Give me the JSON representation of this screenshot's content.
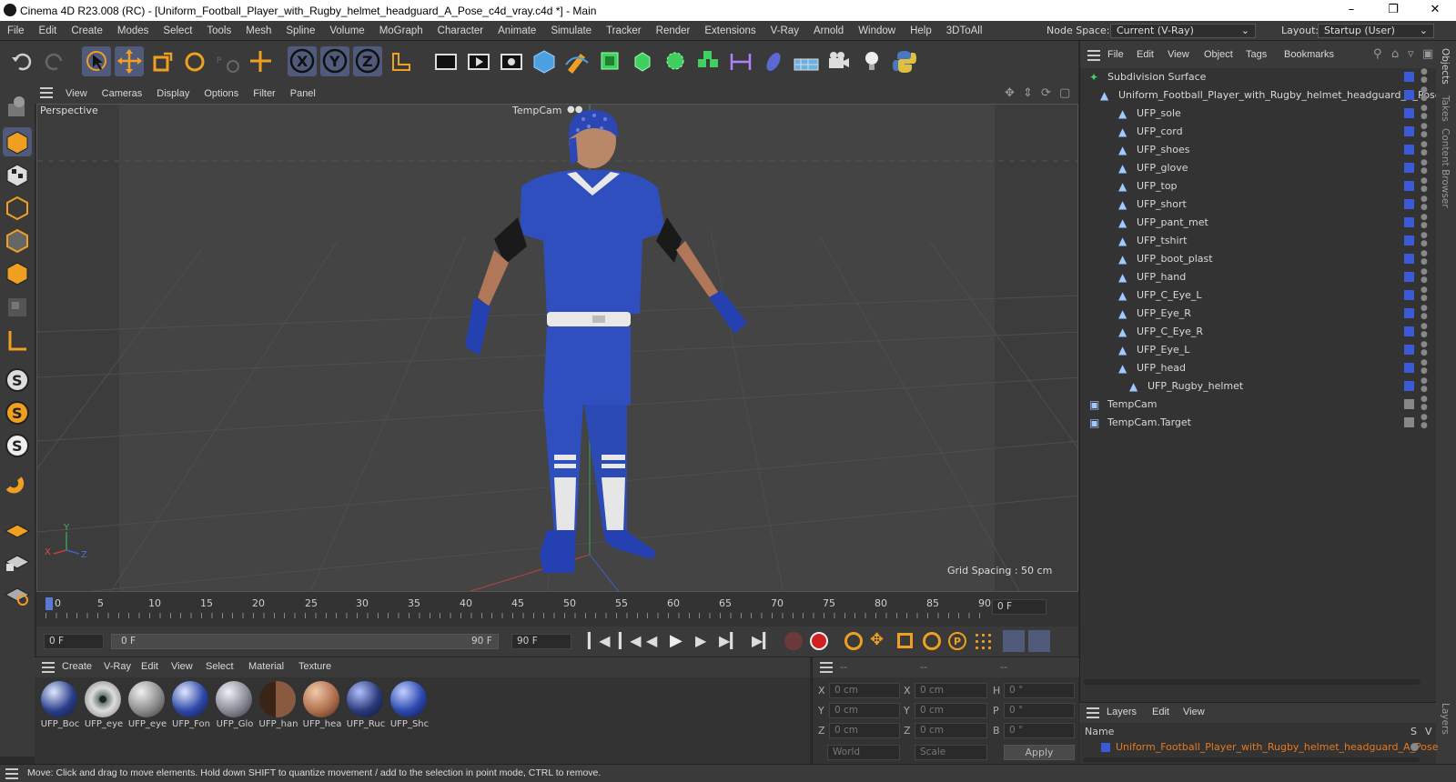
{
  "window": {
    "title": "Cinema 4D R23.008 (RC) - [Uniform_Football_Player_with_Rugby_helmet_headguard_A_Pose_c4d_vray.c4d *] - Main",
    "controls": [
      "–",
      "❐",
      "✕"
    ]
  },
  "menubar": {
    "items": [
      "File",
      "Edit",
      "Create",
      "Modes",
      "Select",
      "Tools",
      "Mesh",
      "Spline",
      "Volume",
      "MoGraph",
      "Character",
      "Animate",
      "Simulate",
      "Tracker",
      "Render",
      "Extensions",
      "V-Ray",
      "Arnold",
      "Window",
      "Help",
      "3DToAll"
    ],
    "node_space_label": "Node Space:",
    "node_space_value": "Current (V-Ray)",
    "layout_label": "Layout:",
    "layout_value": "Startup (User)"
  },
  "viewport": {
    "menu": [
      "View",
      "Cameras",
      "Display",
      "Options",
      "Filter",
      "Panel"
    ],
    "view_name": "Perspective",
    "camera_label": "TempCam",
    "grid_spacing": "Grid Spacing : 50 cm",
    "axis_labels": {
      "y": "Y",
      "x": "X",
      "z": "Z"
    }
  },
  "timeline": {
    "ticks": [
      "0",
      "5",
      "10",
      "15",
      "20",
      "25",
      "30",
      "35",
      "40",
      "45",
      "50",
      "55",
      "60",
      "65",
      "70",
      "75",
      "80",
      "85",
      "90"
    ],
    "current_frame_display": "0 F",
    "start_field": "0 F",
    "range_start": "0 F",
    "range_end": "90 F",
    "end_field": "90 F"
  },
  "material_manager": {
    "menu": [
      "Create",
      "V-Ray",
      "Edit",
      "View",
      "Select",
      "Material",
      "Texture"
    ],
    "materials": [
      {
        "name": "UFP_Boc",
        "color": "#2a3e8a"
      },
      {
        "name": "UFP_eye",
        "color": "#9a9a9a"
      },
      {
        "name": "UFP_eye",
        "color": "#8c8c8c"
      },
      {
        "name": "UFP_Fon",
        "color": "#2c47a8"
      },
      {
        "name": "UFP_Glo",
        "color": "#8a8a96"
      },
      {
        "name": "UFP_han",
        "color": "#8a5a40"
      },
      {
        "name": "UFP_hea",
        "color": "#b07050"
      },
      {
        "name": "UFP_Ruc",
        "color": "#2a3a7a"
      },
      {
        "name": "UFP_Shc",
        "color": "#2c48b0"
      }
    ]
  },
  "coordinates": {
    "headers": [
      "--",
      "--",
      "--"
    ],
    "rows": [
      {
        "a_label": "X",
        "a_val": "0 cm",
        "b_label": "X",
        "b_val": "0 cm",
        "c_label": "H",
        "c_val": "0 °"
      },
      {
        "a_label": "Y",
        "a_val": "0 cm",
        "b_label": "Y",
        "b_val": "0 cm",
        "c_label": "P",
        "c_val": "0 °"
      },
      {
        "a_label": "Z",
        "a_val": "0 cm",
        "b_label": "Z",
        "b_val": "0 cm",
        "c_label": "B",
        "c_val": "0 °"
      }
    ],
    "world": "World",
    "scale": "Scale",
    "apply": "Apply"
  },
  "object_manager": {
    "menu": [
      "File",
      "Edit",
      "View",
      "Object",
      "Tags",
      "Bookmarks"
    ],
    "objects": [
      {
        "label": "Subdivision Surface",
        "indent": 0
      },
      {
        "label": "Uniform_Football_Player_with_Rugby_helmet_headguard_A_Pose",
        "indent": 1
      },
      {
        "label": "UFP_sole",
        "indent": 2
      },
      {
        "label": "UFP_cord",
        "indent": 2
      },
      {
        "label": "UFP_shoes",
        "indent": 2
      },
      {
        "label": "UFP_glove",
        "indent": 2
      },
      {
        "label": "UFP_top",
        "indent": 2
      },
      {
        "label": "UFP_short",
        "indent": 2
      },
      {
        "label": "UFP_pant_met",
        "indent": 2
      },
      {
        "label": "UFP_tshirt",
        "indent": 2
      },
      {
        "label": "UFP_boot_plast",
        "indent": 2
      },
      {
        "label": "UFP_hand",
        "indent": 2
      },
      {
        "label": "UFP_C_Eye_L",
        "indent": 2
      },
      {
        "label": "UFP_Eye_R",
        "indent": 2
      },
      {
        "label": "UFP_C_Eye_R",
        "indent": 2
      },
      {
        "label": "UFP_Eye_L",
        "indent": 2
      },
      {
        "label": "UFP_head",
        "indent": 2
      },
      {
        "label": "UFP_Rugby_helmet",
        "indent": 3
      },
      {
        "label": "TempCam",
        "indent": 0
      },
      {
        "label": "TempCam.Target",
        "indent": 0
      }
    ]
  },
  "layers": {
    "menu": [
      "Layers",
      "Edit",
      "View"
    ],
    "col_name": "Name",
    "col_s": "S",
    "col_v": "V",
    "layer_name": "Uniform_Football_Player_with_Rugby_helmet_headguard_A_Pose"
  },
  "right_tabs": [
    "Objects",
    "Takes",
    "Content Browser",
    "Layers"
  ],
  "status": {
    "text": "Move: Click and drag to move elements. Hold down SHIFT to quantize movement / add to the selection in point mode, CTRL to remove."
  },
  "colors": {
    "accent_blue": "#3b5bd6",
    "layer_orange": "#e8781e",
    "uniform_blue": "#2f4fbf"
  }
}
